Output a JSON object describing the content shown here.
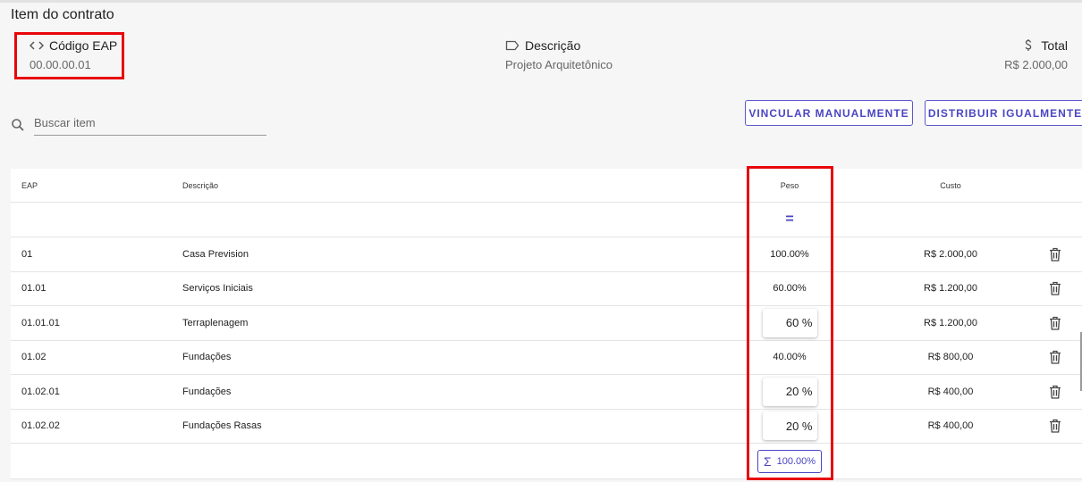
{
  "page": {
    "title": "Item do contrato"
  },
  "meta": {
    "eap": {
      "label": "Código EAP",
      "value": "00.00.00.01",
      "icon": "code-icon"
    },
    "descricao": {
      "label": "Descrição",
      "value": "Projeto Arquitetônico",
      "icon": "label-tag-icon"
    },
    "total": {
      "label": "Total",
      "value": "R$ 2.000,00",
      "icon": "dollar-icon"
    }
  },
  "search": {
    "placeholder": "Buscar item"
  },
  "buttons": {
    "vincular": "VINCULAR MANUALMENTE",
    "distribuir": "DISTRIBUIR IGUALMENTE"
  },
  "table": {
    "headers": {
      "eap": "EAP",
      "descricao": "Descrição",
      "peso": "Peso",
      "custo": "Custo"
    },
    "equal_symbol": "=",
    "rows": [
      {
        "eap": "01",
        "descricao": "Casa Prevision",
        "peso": "100.00%",
        "custo": "R$ 2.000,00"
      },
      {
        "eap": "01.01",
        "descricao": "Serviços Iniciais",
        "peso": "60.00%",
        "custo": "R$ 1.200,00"
      },
      {
        "eap": "01.01.01",
        "descricao": "Terraplenagem",
        "peso_input": "60 %",
        "custo": "R$ 1.200,00"
      },
      {
        "eap": "01.02",
        "descricao": "Fundações",
        "peso": "40.00%",
        "custo": "R$ 800,00"
      },
      {
        "eap": "01.02.01",
        "descricao": "Fundações",
        "peso_input": "20 %",
        "custo": "R$ 400,00"
      },
      {
        "eap": "01.02.02",
        "descricao": "Fundações Rasas",
        "peso_input": "20 %",
        "custo": "R$ 400,00"
      }
    ],
    "footer": {
      "sum_symbol": "Σ",
      "sum_value": "100.00%"
    }
  },
  "colors": {
    "accent": "#4a45c2",
    "highlight": "#e8060a"
  }
}
